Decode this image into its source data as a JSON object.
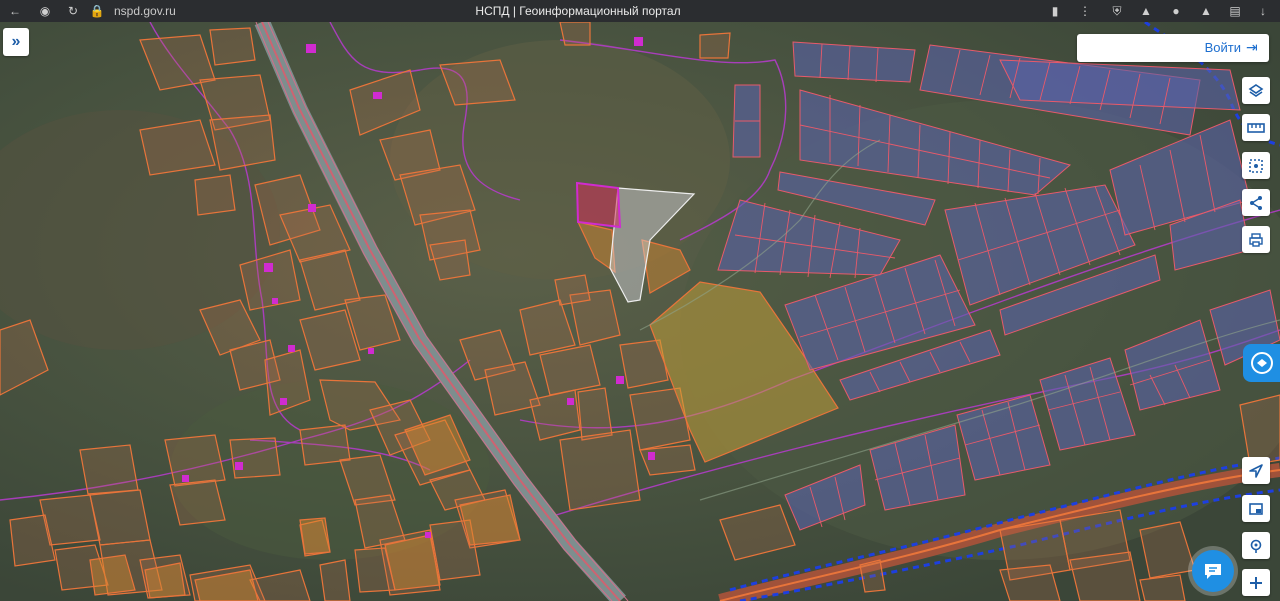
{
  "browser": {
    "url": "nspd.gov.ru",
    "title": "НСПД | Геоинформационный портал"
  },
  "header": {
    "login_label": "Войти"
  },
  "colors": {
    "road": "#8a9a9a",
    "parcel_outline": "#e8743a",
    "parcel_fill": "#c97a3e",
    "zone_fill": "#5a63a8",
    "zone_outline": "#e85a6a",
    "boundary": "#b23cc8",
    "dashed_border": "#1d3fe0",
    "accent": "#1f8fe3"
  },
  "icons": {
    "expand": "double-chevron-right-icon",
    "login": "login-arrow-icon",
    "layers": "layers-icon",
    "measure": "ruler-icon",
    "select": "area-select-icon",
    "share": "share-icon",
    "print": "printer-icon",
    "locate": "navigation-arrow-icon",
    "minimap": "minimap-icon",
    "search_place": "place-search-icon",
    "zoom_in": "plus-icon",
    "chat": "chat-icon",
    "feedback": "feedback-icon"
  }
}
